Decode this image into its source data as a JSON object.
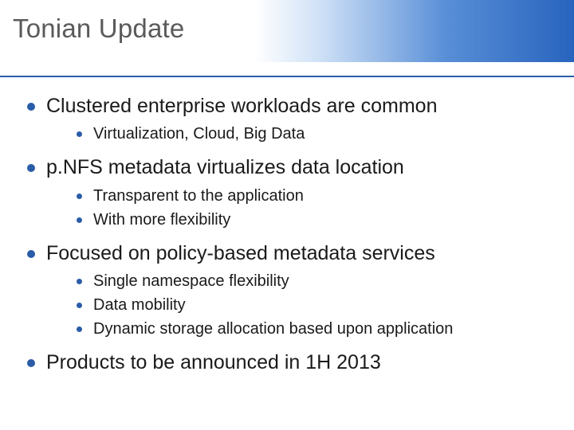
{
  "title": "Tonian Update",
  "bullets": [
    {
      "text": "Clustered enterprise workloads are common",
      "sub": [
        "Virtualization, Cloud, Big Data"
      ]
    },
    {
      "text": "p.NFS metadata virtualizes data location",
      "sub": [
        "Transparent to the application",
        "With more flexibility"
      ]
    },
    {
      "text": "Focused on policy-based metadata services",
      "sub": [
        "Single namespace flexibility",
        "Data mobility",
        "Dynamic storage allocation based upon application"
      ]
    },
    {
      "text": "Products to be announced in 1H 2013",
      "sub": []
    }
  ]
}
